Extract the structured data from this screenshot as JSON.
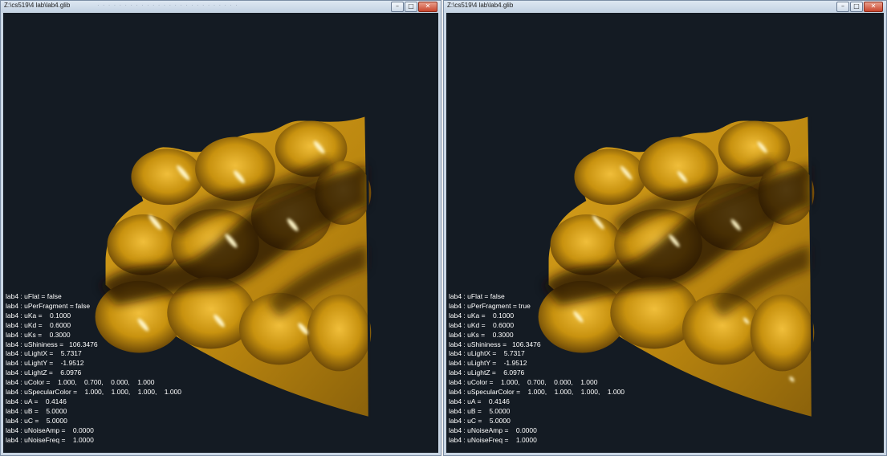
{
  "windows": [
    {
      "title": "Z:\\cs519\\4 lab\\lab4.glib",
      "controls": {
        "minimize": "–",
        "maximize": "□",
        "close": "✕"
      },
      "params": [
        "lab4 : uFlat = false",
        "lab4 : uPerFragment = false",
        "lab4 : uKa =    0.1000",
        "lab4 : uKd =    0.6000",
        "lab4 : uKs =    0.3000",
        "lab4 : uShininess =   106.3476",
        "lab4 : uLightX =    5.7317",
        "lab4 : uLightY =    -1.9512",
        "lab4 : uLightZ =    6.0976",
        "lab4 : uColor =    1.000,    0.700,    0.000,    1.000",
        "lab4 : uSpecularColor =    1.000,    1.000,    1.000,    1.000",
        "lab4 : uA =    0.4146",
        "lab4 : uB =    5.0000",
        "lab4 : uC =    5.0000",
        "lab4 : uNoiseAmp =    0.0000",
        "lab4 : uNoiseFreq =    1.0000"
      ]
    },
    {
      "title": "Z:\\cs519\\4 lab\\lab4.glib",
      "controls": {
        "minimize": "–",
        "maximize": "□",
        "close": "✕"
      },
      "params": [
        "lab4 : uFlat = false",
        "lab4 : uPerFragment = true",
        "lab4 : uKa =    0.1000",
        "lab4 : uKd =    0.6000",
        "lab4 : uKs =    0.3000",
        "lab4 : uShininess =   106.3476",
        "lab4 : uLightX =    5.7317",
        "lab4 : uLightY =    -1.9512",
        "lab4 : uLightZ =    6.0976",
        "lab4 : uColor =    1.000,    0.700,    0.000,    1.000",
        "lab4 : uSpecularColor =    1.000,    1.000,    1.000,    1.000",
        "lab4 : uA =    0.4146",
        "lab4 : uB =    5.0000",
        "lab4 : uC =    5.0000",
        "lab4 : uNoiseAmp =    0.0000",
        "lab4 : uNoiseFreq =    1.0000"
      ]
    }
  ],
  "colors": {
    "viewport_bg": "#141b23",
    "surface": "#c8920f",
    "surface_light": "#e8b22a",
    "surface_dark": "#2a1a04",
    "specular": "#fff6c8"
  }
}
